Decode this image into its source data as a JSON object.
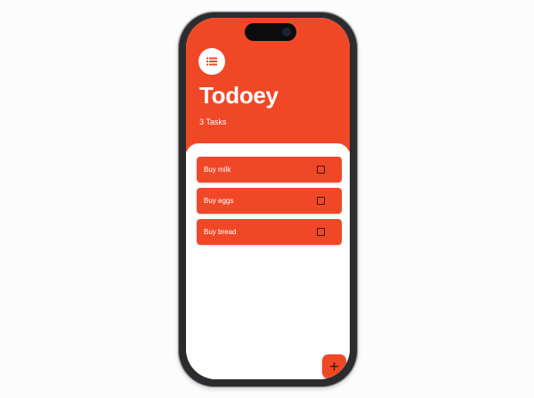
{
  "app": {
    "title": "Todoey",
    "task_count_label": "3 Tasks",
    "accent_color": "#f04827"
  },
  "header": {
    "menu_icon": "list-icon"
  },
  "tasks": [
    {
      "label": "Buy milk",
      "checked": false
    },
    {
      "label": "Buy eggs",
      "checked": false
    },
    {
      "label": "Buy bread",
      "checked": false
    }
  ],
  "fab": {
    "icon": "plus-icon"
  }
}
